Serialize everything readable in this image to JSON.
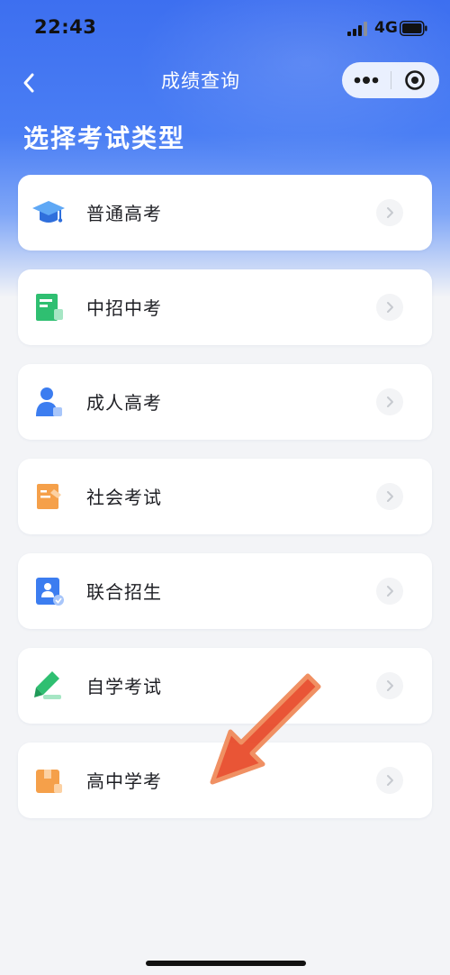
{
  "status_bar": {
    "time": "22:43",
    "network": "4G"
  },
  "nav": {
    "title": "成绩查询"
  },
  "heading": "选择考试类型",
  "items": [
    {
      "label": "普通高考",
      "icon": "graduation-cap-icon",
      "color": "#3f8ef0"
    },
    {
      "label": "中招中考",
      "icon": "book-icon",
      "color": "#2fbf71"
    },
    {
      "label": "成人高考",
      "icon": "person-icon",
      "color": "#3c7df0"
    },
    {
      "label": "社会考试",
      "icon": "document-edit-icon",
      "color": "#f5a04a"
    },
    {
      "label": "联合招生",
      "icon": "person-card-icon",
      "color": "#3c7df0"
    },
    {
      "label": "自学考试",
      "icon": "pencil-icon",
      "color": "#2fbf71"
    },
    {
      "label": "高中学考",
      "icon": "box-icon",
      "color": "#f5a04a"
    }
  ],
  "colors": {
    "header_blue": "#3d6ff0",
    "background": "#f3f4f7",
    "annotation_arrow": "#e84b2a"
  }
}
